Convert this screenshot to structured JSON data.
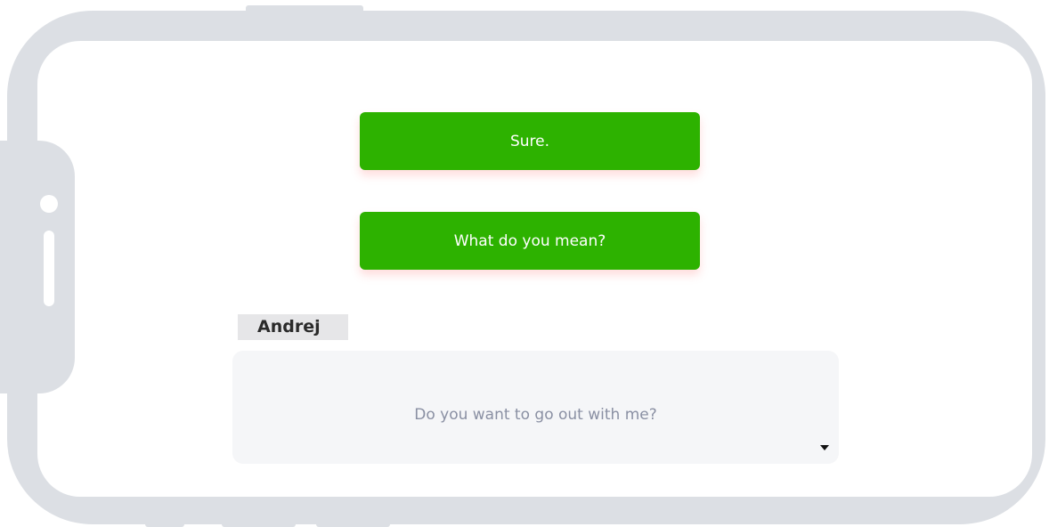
{
  "choices": [
    {
      "label": "Sure."
    },
    {
      "label": "What do you mean?"
    }
  ],
  "dialogue": {
    "speaker": "Andrej",
    "text": "Do you want to go out with me?",
    "advance_icon": "caret-down-icon"
  },
  "colors": {
    "choice_background": "#2db200",
    "phone_frame": "#dcdfe4",
    "dialogue_background": "#f5f6f8",
    "dialogue_text": "#8a90a3"
  }
}
